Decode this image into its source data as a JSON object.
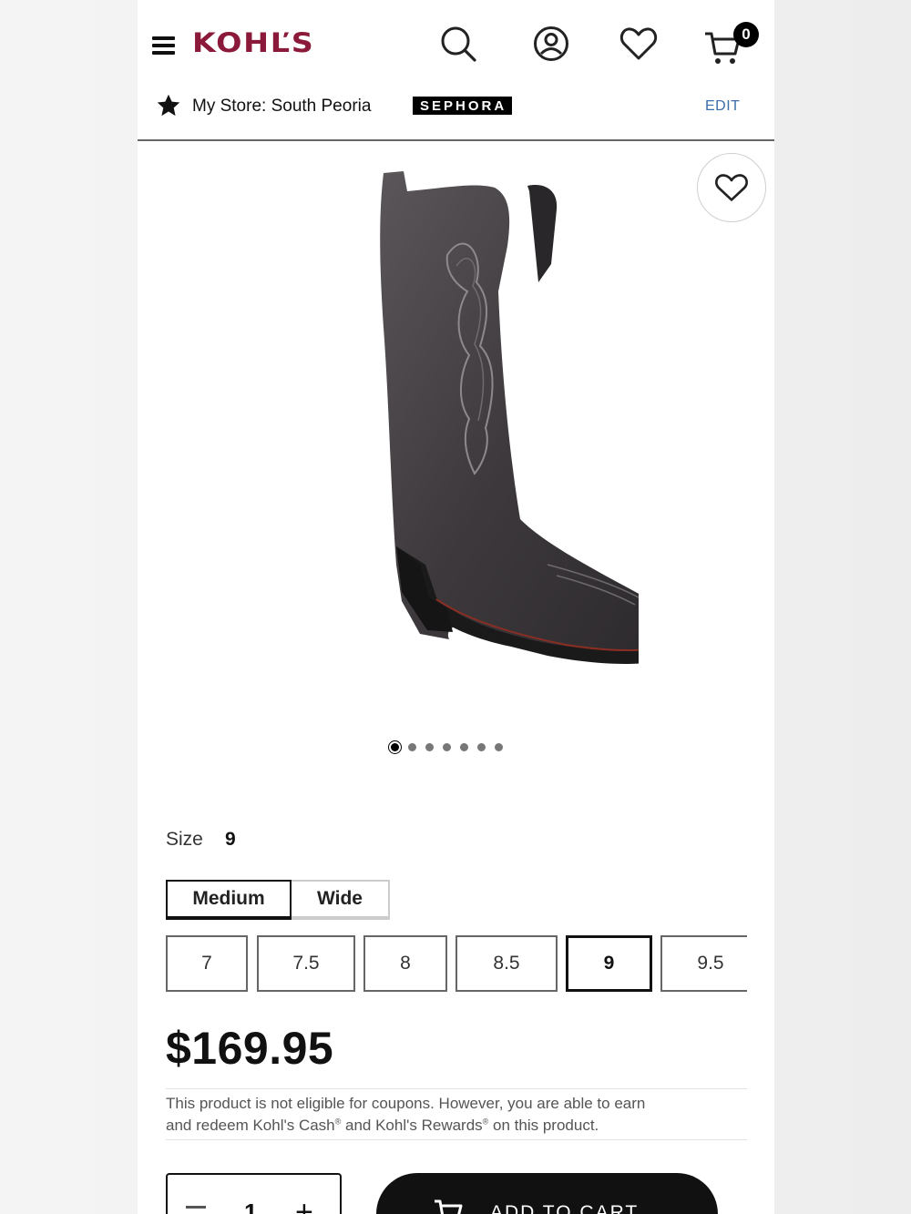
{
  "header": {
    "logo_text": "KOHĽS",
    "cart_count": "0"
  },
  "store": {
    "label": "My Store: South Peoria",
    "partner_badge": "SEPHORA",
    "edit_label": "EDIT"
  },
  "gallery": {
    "image_count": 7,
    "active_index": 0
  },
  "size": {
    "label": "Size",
    "selected_value": "9",
    "widths": [
      "Medium",
      "Wide"
    ],
    "selected_width": "Medium",
    "options": [
      "7",
      "7.5",
      "8",
      "8.5",
      "9",
      "9.5"
    ]
  },
  "price": "$169.95",
  "coupon_notice": {
    "line1": "This product is not eligible for coupons. However, you are able to earn",
    "line2_part1": "and redeem Kohl's Cash",
    "line2_part2": " and Kohl's Rewards",
    "line2_part3": " on this product.",
    "reg_mark": "®"
  },
  "quantity": {
    "value": "1",
    "minus": "−",
    "plus": "+"
  },
  "add_to_cart_label": "ADD TO CART",
  "colors": {
    "brand": "#8b1a3a",
    "edit_link": "#3b6ea8",
    "button_bg": "#111111"
  }
}
